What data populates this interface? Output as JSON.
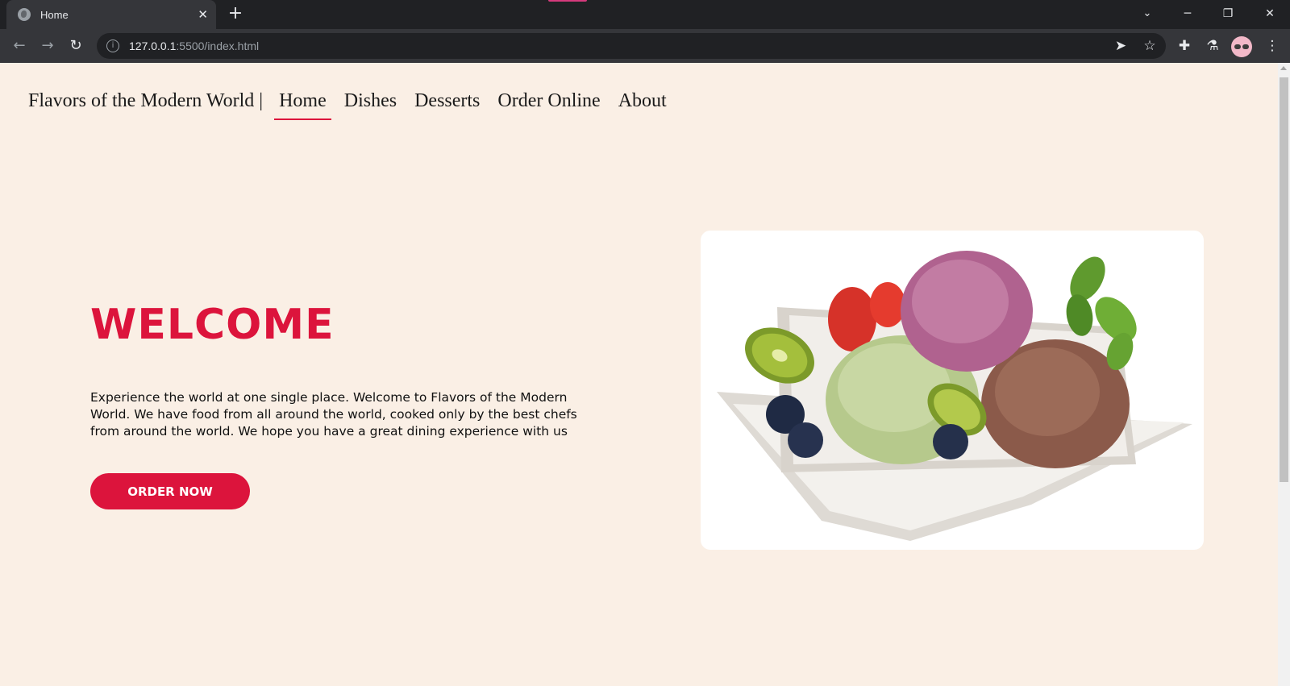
{
  "browser": {
    "tab_title": "Home",
    "close_glyph": "✕",
    "new_tab_glyph": "+",
    "url_host": "127.0.0.1",
    "url_path": ":5500/index.html",
    "icons": [
      "globe-icon",
      "close-icon",
      "plus-icon",
      "chevron-down-icon",
      "minimize-icon",
      "restore-icon",
      "window-close-icon",
      "back-arrow-icon",
      "forward-arrow-icon",
      "reload-icon",
      "info-icon",
      "send-icon",
      "star-icon",
      "puzzle-icon",
      "flask-icon",
      "avatar",
      "kebab-menu-icon"
    ]
  },
  "nav": {
    "brand": "Flavors of the Modern World",
    "separator": "|",
    "links": [
      "Home",
      "Dishes",
      "Desserts",
      "Order Online",
      "About"
    ],
    "active": "Home"
  },
  "hero": {
    "heading": "WELCOME",
    "text": "Experience the world at one single place. Welcome to Flavors of the Modern World. We have food from all around the world, cooked only by the best chefs from around the world. We hope you have a great dining experience with us",
    "button": "ORDER NOW",
    "image_alt": "ice-cream-dessert-image"
  },
  "colors": {
    "accent": "#dc143c",
    "page_bg": "#faefe5",
    "chrome_bg": "#202124",
    "toolbar_bg": "#35363a"
  }
}
